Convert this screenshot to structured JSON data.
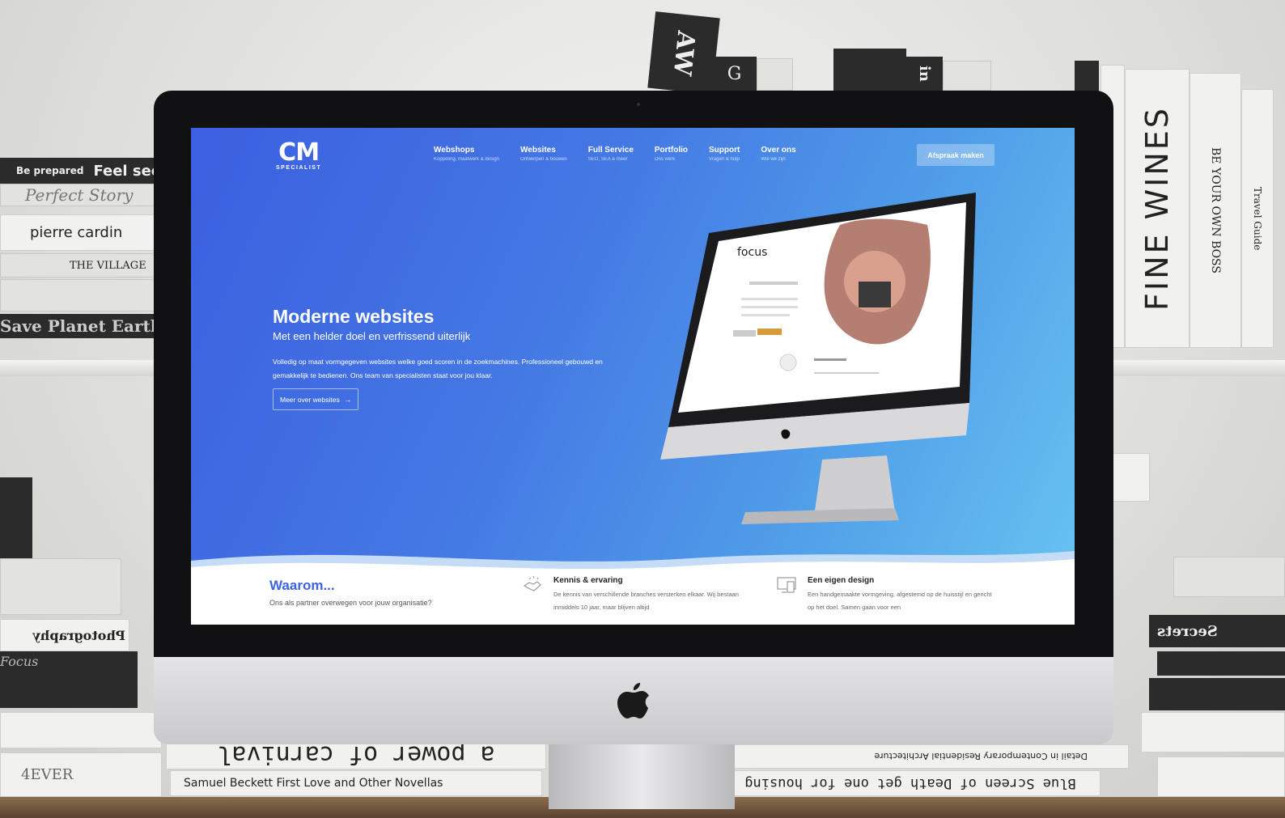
{
  "scene": {
    "books_left": [
      "Be prepared",
      "Feel secure",
      "Perfect Story",
      "pierre cardin",
      "THE VILLAGE",
      "Save Planet Earth",
      "Photography",
      "Focus",
      "4EVER"
    ],
    "books_right": [
      "FINE WINES",
      "BE YOUR OWN BOSS",
      "Travel Guide",
      "Secrets"
    ],
    "books_bottom": [
      "a power of carnival",
      "Samuel Beckett First Love and Other Novellas",
      "Detail in Contemporary Residential Architecture",
      "Blue Screen of Death get one for housing"
    ],
    "books_top": [
      "AW",
      "G",
      "in"
    ]
  },
  "header": {
    "logo_mark": "CM",
    "logo_sub": "SPECIALIST",
    "nav": [
      {
        "label": "Webshops",
        "sub": "Koppeling, maatwerk & design"
      },
      {
        "label": "Websites",
        "sub": "Ontwerpen & bouwen"
      },
      {
        "label": "Full Service",
        "sub": "SEO, SEA & meer"
      },
      {
        "label": "Portfolio",
        "sub": "Ons werk"
      },
      {
        "label": "Support",
        "sub": "Vragen & hulp"
      },
      {
        "label": "Over ons",
        "sub": "Wie we zijn"
      }
    ],
    "cta": "Afspraak maken"
  },
  "hero": {
    "title": "Moderne websites",
    "subtitle": "Met een helder doel en verfrissend uiterlijk",
    "text": "Volledig op maat vormgegeven websites welke goed scoren in de zoekmachines. Professioneel gebouwd en gemakkelijk te bedienen. Ons team van specialisten staat voor jou klaar.",
    "button": "Meer over websites",
    "button_arrow": "→",
    "mockup_brand": "focus"
  },
  "why": {
    "title": "Waarom...",
    "subtitle": "Ons als partner overwegen voor jouw organisatie?",
    "features": [
      {
        "title": "Kennis & ervaring",
        "text": "De kennis van verschillende branches versterken elkaar. Wij bestaan inmiddels 10 jaar, maar blijven altijd",
        "icon": "handshake-icon"
      },
      {
        "title": "Een eigen design",
        "text": "Een handgemaakte vormgeving, afgestemd op de huisstijl en gericht op het doel. Samen gaan voor een",
        "icon": "monitor-icon"
      }
    ]
  },
  "colors": {
    "hero_start": "#3b5fe0",
    "hero_end": "#66c1f0",
    "accent": "#3d63e2"
  }
}
